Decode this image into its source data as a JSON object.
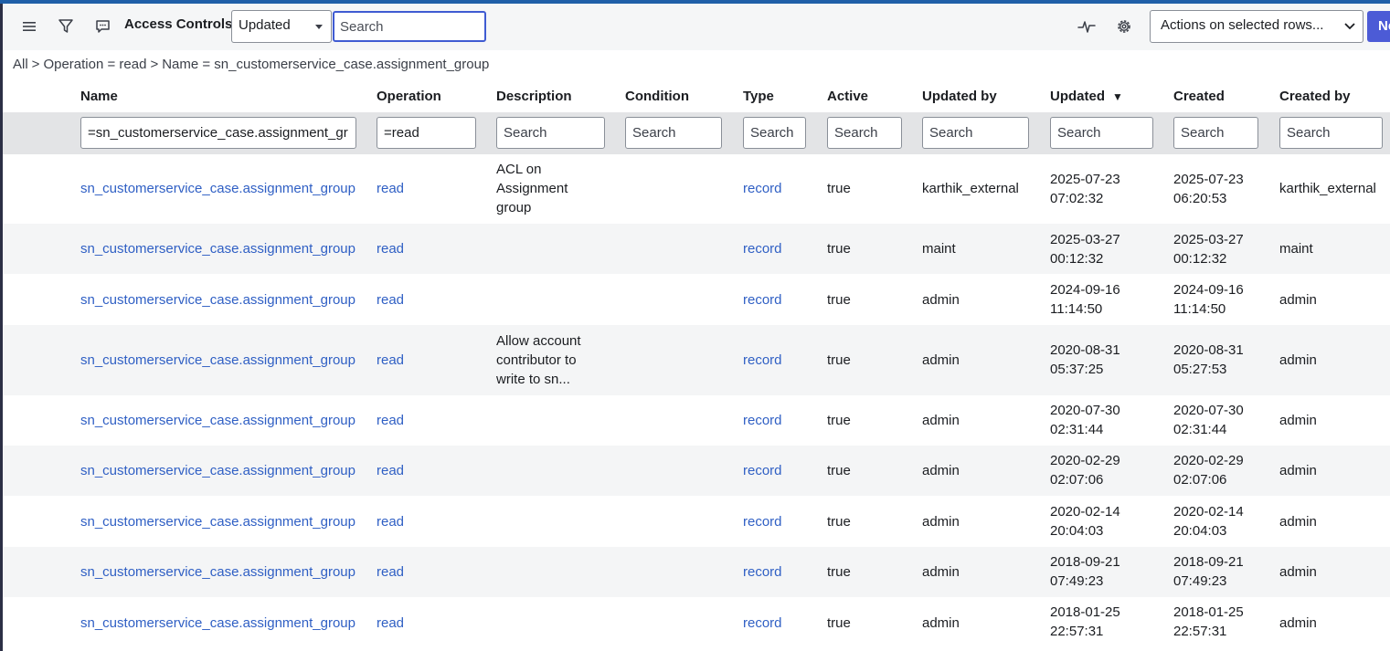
{
  "header": {
    "title": "Access Controls",
    "sort_select_value": "Updated",
    "search_placeholder": "Search",
    "actions_select_value": "Actions on selected rows...",
    "new_button_label": "Ne"
  },
  "breadcrumb": [
    "All",
    "Operation = read",
    "Name = sn_customerservice_case.assignment_group"
  ],
  "breadcrumb_sep": ">",
  "columns": [
    "Name",
    "Operation",
    "Description",
    "Condition",
    "Type",
    "Active",
    "Updated by",
    "Updated",
    "Created",
    "Created by"
  ],
  "sort_indicator": "▼",
  "filters": {
    "name": "=sn_customerservice_case.assignment_gr",
    "operation": "=read",
    "placeholder": "Search"
  },
  "rows": [
    {
      "name": "sn_customerservice_case.assignment_group",
      "operation": "read",
      "description": "ACL on Assignment group",
      "type": "record",
      "active": "true",
      "updated_by": "karthik_external",
      "updated_date": "2025-07-23",
      "updated_time": "07:02:32",
      "created_date": "2025-07-23",
      "created_time": "06:20:53",
      "created_by": "karthik_external"
    },
    {
      "name": "sn_customerservice_case.assignment_group",
      "operation": "read",
      "description": "",
      "type": "record",
      "active": "true",
      "updated_by": "maint",
      "updated_date": "2025-03-27",
      "updated_time": "00:12:32",
      "created_date": "2025-03-27",
      "created_time": "00:12:32",
      "created_by": "maint"
    },
    {
      "name": "sn_customerservice_case.assignment_group",
      "operation": "read",
      "description": "",
      "type": "record",
      "active": "true",
      "updated_by": "admin",
      "updated_date": "2024-09-16",
      "updated_time": "11:14:50",
      "created_date": "2024-09-16",
      "created_time": "11:14:50",
      "created_by": "admin"
    },
    {
      "name": "sn_customerservice_case.assignment_group",
      "operation": "read",
      "description": "Allow account contributor to write to sn...",
      "type": "record",
      "active": "true",
      "updated_by": "admin",
      "updated_date": "2020-08-31",
      "updated_time": "05:37:25",
      "created_date": "2020-08-31",
      "created_time": "05:27:53",
      "created_by": "admin"
    },
    {
      "name": "sn_customerservice_case.assignment_group",
      "operation": "read",
      "description": "",
      "type": "record",
      "active": "true",
      "updated_by": "admin",
      "updated_date": "2020-07-30",
      "updated_time": "02:31:44",
      "created_date": "2020-07-30",
      "created_time": "02:31:44",
      "created_by": "admin"
    },
    {
      "name": "sn_customerservice_case.assignment_group",
      "operation": "read",
      "description": "",
      "type": "record",
      "active": "true",
      "updated_by": "admin",
      "updated_date": "2020-02-29",
      "updated_time": "02:07:06",
      "created_date": "2020-02-29",
      "created_time": "02:07:06",
      "created_by": "admin"
    },
    {
      "name": "sn_customerservice_case.assignment_group",
      "operation": "read",
      "description": "",
      "type": "record",
      "active": "true",
      "updated_by": "admin",
      "updated_date": "2020-02-14",
      "updated_time": "20:04:03",
      "created_date": "2020-02-14",
      "created_time": "20:04:03",
      "created_by": "admin"
    },
    {
      "name": "sn_customerservice_case.assignment_group",
      "operation": "read",
      "description": "",
      "type": "record",
      "active": "true",
      "updated_by": "admin",
      "updated_date": "2018-09-21",
      "updated_time": "07:49:23",
      "created_date": "2018-09-21",
      "created_time": "07:49:23",
      "created_by": "admin"
    },
    {
      "name": "sn_customerservice_case.assignment_group",
      "operation": "read",
      "description": "",
      "type": "record",
      "active": "true",
      "updated_by": "admin",
      "updated_date": "2018-01-25",
      "updated_time": "22:57:31",
      "created_date": "2018-01-25",
      "created_time": "22:57:31",
      "created_by": "admin"
    }
  ],
  "colors": {
    "link": "#2f5fc4",
    "accent": "#4c5bd6",
    "top_bar": "#1f5fa8"
  },
  "icons": [
    "hamburger-menu-icon",
    "filter-funnel-icon",
    "comment-icon",
    "search-icon",
    "activity-pulse-icon",
    "gear-icon"
  ]
}
